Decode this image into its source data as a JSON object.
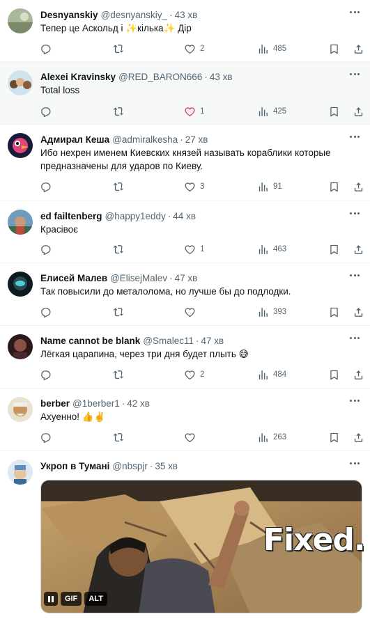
{
  "tweets": [
    {
      "name": "Desnyanskiy",
      "handle": "@desnyanskiy_",
      "time": "43 хв",
      "text": "Тепер це Аскольд і ✨кілька✨ Дір",
      "replies": "",
      "retweets": "",
      "likes": "2",
      "views": "485"
    },
    {
      "name": "Alexei Kravinsky",
      "handle": "@RED_BARON666",
      "time": "43 хв",
      "text": "Total loss",
      "replies": "",
      "retweets": "",
      "likes": "1",
      "views": "425"
    },
    {
      "name": "Адмирал Кеша",
      "handle": "@admiralkesha",
      "time": "27 хв",
      "text": "Ибо нехрен именем Киевских князей называть кораблики которые предназначены для ударов по Киеву.",
      "replies": "",
      "retweets": "",
      "likes": "3",
      "views": "91"
    },
    {
      "name": "ed failtenberg",
      "handle": "@happy1eddy",
      "time": "44 хв",
      "text": "Красівоє",
      "replies": "",
      "retweets": "",
      "likes": "1",
      "views": "463"
    },
    {
      "name": "Елисей Малев",
      "handle": "@ElisejMalev",
      "time": "47 хв",
      "text": "Так повысили до металолома, но лучше бы до подлодки.",
      "replies": "",
      "retweets": "",
      "likes": "",
      "views": "393"
    },
    {
      "name": "Name cannot be blank",
      "handle": "@Smalec11",
      "time": "47 хв",
      "text": "Лёгкая царапина, через три дня будет плыть 😅",
      "replies": "",
      "retweets": "",
      "likes": "2",
      "views": "484"
    },
    {
      "name": "berber",
      "handle": "@1berber1",
      "time": "42 хв",
      "text": "Ахуенно! 👍✌️",
      "replies": "",
      "retweets": "",
      "likes": "",
      "views": "263"
    },
    {
      "name": "Укроп в Тумані",
      "handle": "@nbspjr",
      "time": "35 хв",
      "text": ""
    }
  ],
  "media": {
    "gif_label": "GIF",
    "alt_label": "ALT",
    "caption": "Fixed."
  },
  "icons": {
    "reply": "reply-icon",
    "retweet": "retweet-icon",
    "like": "heart-icon",
    "views": "views-icon",
    "bookmark": "bookmark-icon",
    "share": "share-icon",
    "more": "more-icon"
  },
  "colors": {
    "text": "#0f1419",
    "muted": "#536471",
    "like_accent": "#c13e8c",
    "highlight_bg": "#f7f9f9"
  }
}
